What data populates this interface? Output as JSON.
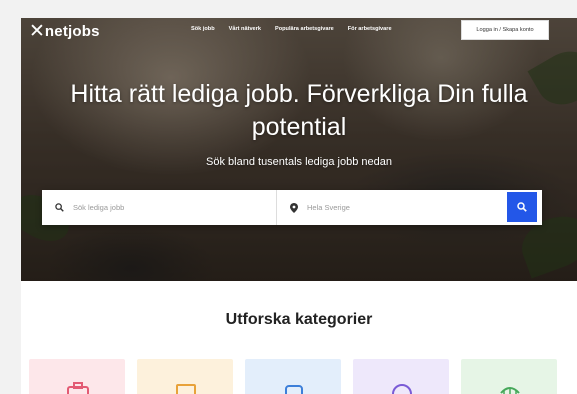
{
  "nav": {
    "brand": "netjobs",
    "links": [
      "Sök jobb",
      "Vårt nätverk",
      "Populära arbetsgivare",
      "För arbetsgivare"
    ],
    "login_label": "Logga in / Skapa konto"
  },
  "hero": {
    "headline": "Hitta rätt lediga jobb. Förverkliga Din fulla potential",
    "subline": "Sök bland tusentals lediga jobb nedan"
  },
  "search": {
    "job_placeholder": "Sök lediga jobb",
    "location_placeholder": "Hela Sverige"
  },
  "categories": {
    "title": "Utforska kategorier",
    "tiles": [
      {
        "icon": "briefcase-icon",
        "bg": "#fde7ea",
        "fg": "#e35b74"
      },
      {
        "icon": "document-icon",
        "bg": "#fdf1dc",
        "fg": "#e8a23a"
      },
      {
        "icon": "laptop-icon",
        "bg": "#e3eefb",
        "fg": "#3d7fd9"
      },
      {
        "icon": "chat-icon",
        "bg": "#eee8fb",
        "fg": "#7a5bd6"
      },
      {
        "icon": "shop-icon",
        "bg": "#e6f5e6",
        "fg": "#46a85a"
      }
    ]
  },
  "colors": {
    "accent": "#2357e8"
  }
}
